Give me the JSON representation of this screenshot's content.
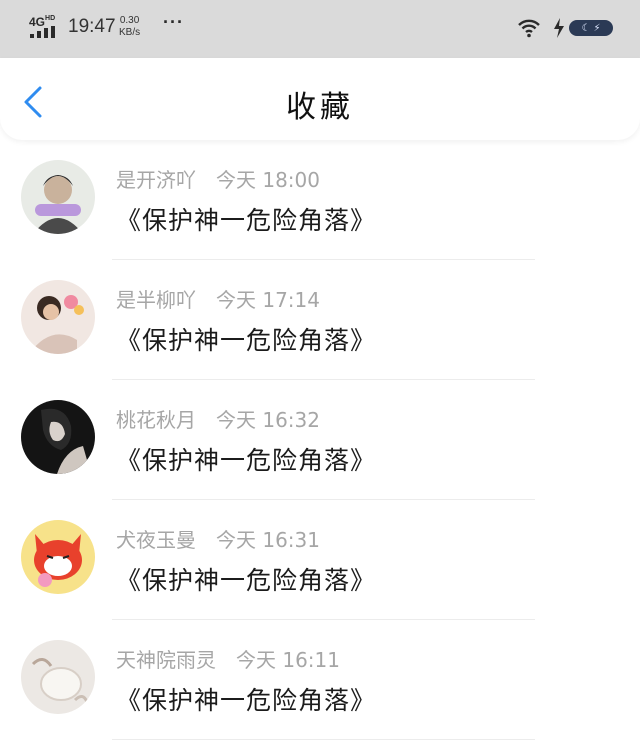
{
  "status_bar": {
    "network": "4G",
    "network_sup": "HD",
    "time": "19:47",
    "speed_value": "0.30",
    "speed_unit": "KB/s",
    "more": "···"
  },
  "nav": {
    "title": "收藏"
  },
  "favorites": [
    {
      "user": "是开济吖",
      "time": "今天 18:00",
      "title": "《保护神一危险角落》"
    },
    {
      "user": "是半柳吖",
      "time": "今天 17:14",
      "title": "《保护神一危险角落》"
    },
    {
      "user": "桃花秋月",
      "time": "今天 16:32",
      "title": "《保护神一危险角落》"
    },
    {
      "user": "犬夜玉曼",
      "time": "今天 16:31",
      "title": "《保护神一危险角落》"
    },
    {
      "user": "天神院雨灵",
      "time": "今天 16:11",
      "title": "《保护神一危险角落》"
    }
  ],
  "colors": {
    "accent": "#2f8cf0",
    "status_bar_bg": "#dadada",
    "meta_text": "#a6a6a6"
  }
}
